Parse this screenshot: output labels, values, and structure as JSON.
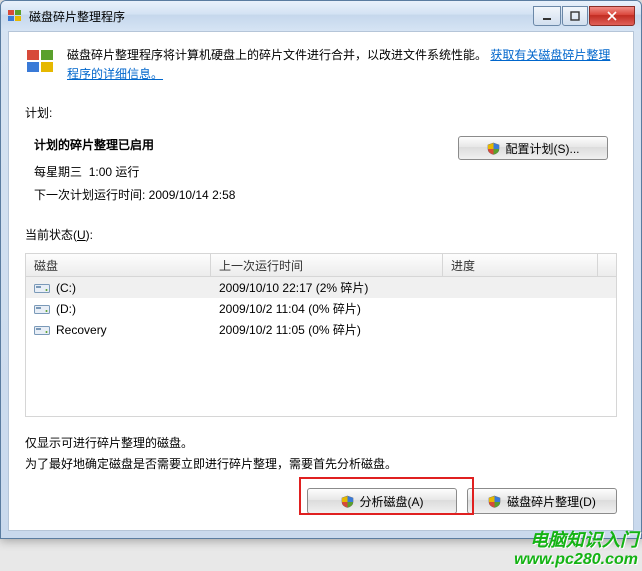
{
  "window": {
    "title": "磁盘碎片整理程序"
  },
  "intro": {
    "text_before_link": "磁盘碎片整理程序将计算机硬盘上的碎片文件进行合并，以改进文件系统性能。",
    "link": "获取有关磁盘碎片整理程序的详细信息。"
  },
  "labels": {
    "plan": "计划:",
    "current": "当前状态(",
    "current_u": "U",
    "current_after": "):"
  },
  "plan": {
    "header": "计划的碎片整理已启用",
    "schedule_day": "每星期三",
    "schedule_time": "1:00 运行",
    "next_prefix": "下一次计划运行时间: ",
    "next_time": "2009/10/14 2:58",
    "configure_label": "配置计划(S)..."
  },
  "columns": {
    "disk": "磁盘",
    "last": "上一次运行时间",
    "progress": "进度"
  },
  "disks": [
    {
      "name": "(C:)",
      "last": "2009/10/10 22:17 (2% 碎片)",
      "selected": true
    },
    {
      "name": "(D:)",
      "last": "2009/10/2 11:04 (0% 碎片)",
      "selected": false
    },
    {
      "name": "Recovery",
      "last": "2009/10/2 11:05 (0% 碎片)",
      "selected": false
    }
  ],
  "note_line1": "仅显示可进行碎片整理的磁盘。",
  "note_line2": "为了最好地确定磁盘是否需要立即进行碎片整理，需要首先分析磁盘。",
  "buttons": {
    "analyze": "分析磁盘(A)",
    "defrag": "磁盘碎片整理(D)"
  },
  "watermark": {
    "line1": "电脑知识入门",
    "line2": "www.pc280.com"
  }
}
